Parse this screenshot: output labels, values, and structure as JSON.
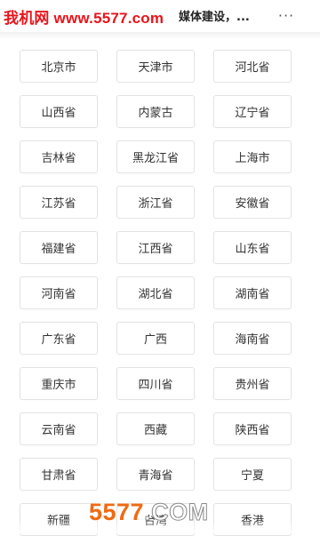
{
  "header": {
    "watermark_text": "我机网 www.5577.com",
    "title": "媒体建设，...",
    "more_icon": "more-horizontal-icon",
    "more_glyph": "···"
  },
  "regions": [
    "北京市",
    "天津市",
    "河北省",
    "山西省",
    "内蒙古",
    "辽宁省",
    "吉林省",
    "黑龙江省",
    "上海市",
    "江苏省",
    "浙江省",
    "安徽省",
    "福建省",
    "江西省",
    "山东省",
    "河南省",
    "湖北省",
    "湖南省",
    "广东省",
    "广西",
    "海南省",
    "重庆市",
    "四川省",
    "贵州省",
    "云南省",
    "西藏",
    "陕西省",
    "甘肃省",
    "青海省",
    "宁夏",
    "新疆",
    "台湾",
    "香港"
  ],
  "bottom_logo": {
    "number": "5577",
    "suffix": ".COM"
  },
  "colors": {
    "watermark": "#e8141b",
    "logo_orange": "#f06a12",
    "button_border": "#e3e3e3",
    "button_text": "#333333"
  }
}
